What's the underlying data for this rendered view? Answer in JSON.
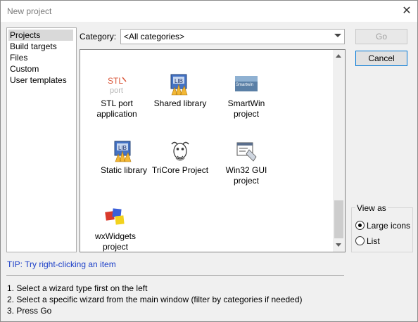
{
  "window": {
    "title": "New project"
  },
  "categories_list": [
    "Projects",
    "Build targets",
    "Files",
    "Custom",
    "User templates"
  ],
  "selected_category": "Projects",
  "category_filter": {
    "label": "Category:",
    "value": "<All categories>"
  },
  "buttons": {
    "go": "Go",
    "cancel": "Cancel"
  },
  "templates": [
    {
      "name": "STL port application",
      "line1": "STL port",
      "line2": "application",
      "icon": "stlport-logo-icon"
    },
    {
      "name": "Shared library",
      "line1": "Shared library",
      "line2": "",
      "icon": "shared-library-icon"
    },
    {
      "name": "SmartWin project",
      "line1": "SmartWin",
      "line2": "project",
      "icon": "smartwin-logo-icon"
    },
    {
      "name": "Static library",
      "line1": "Static library",
      "line2": "",
      "icon": "static-library-icon"
    },
    {
      "name": "TriCore Project",
      "line1": "TriCore Project",
      "line2": "",
      "icon": "gnu-gnu-head-icon"
    },
    {
      "name": "Win32 GUI project",
      "line1": "Win32 GUI",
      "line2": "project",
      "icon": "win32-gui-icon"
    },
    {
      "name": "wxWidgets project",
      "line1": "wxWidgets",
      "line2": "project",
      "icon": "wxwidgets-logo-icon"
    }
  ],
  "icon_text": {
    "lib": "LIB",
    "stl": "STL",
    "port": "port",
    "smartwin": "Smartwin"
  },
  "view_as": {
    "title": "View as",
    "options": [
      "Large icons",
      "List"
    ],
    "selected": "Large icons"
  },
  "tip": "TIP: Try right-clicking an item",
  "steps": [
    "1. Select a wizard type first on the left",
    "2. Select a specific wizard from the main window (filter by categories if needed)",
    "3. Press Go"
  ],
  "colors": {
    "tip": "#1a3ec8",
    "selection": "#d9d9d9",
    "accent": "#0078d7"
  }
}
